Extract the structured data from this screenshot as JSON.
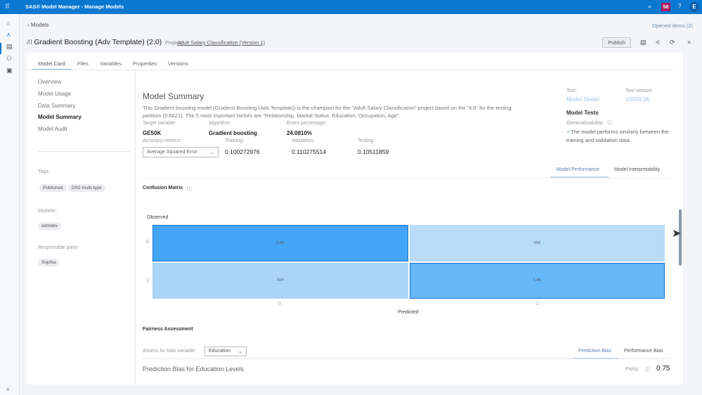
{
  "topbar": {
    "title": "SAS® Model Manager - Manage Models",
    "notifications": "58",
    "avatar": "E",
    "icons": [
      "apps-grid-icon",
      "search-icon",
      "help-icon"
    ]
  },
  "header": {
    "back": "‹ Models",
    "opened_items": "Opened items (2)",
    "model_title": "Gradient Boosting (Adv Template) (2.0)",
    "project_label": "Project:",
    "project_link": "Adult Salary Classification (Version 1)",
    "publish": "Publish"
  },
  "tabs": [
    "Model Card",
    "Files",
    "Variables",
    "Properties",
    "Versions"
  ],
  "nav": [
    "Overview",
    "Model Usage",
    "Data Summary",
    "Model Summary",
    "Model Audit"
  ],
  "sidebar": {
    "tags_label": "Tags:",
    "tags": [
      "Published",
      "DS2 multi-type"
    ],
    "modeler_label": "Modeler:",
    "modeler": "edmdev",
    "responsible_label": "Responsible party:",
    "responsible": "Sophia"
  },
  "summary": {
    "title": "Model Summary",
    "description": "This Gradient boosting model (Gradient Boosting (Adv Template)) is the champion for the \"Adult Salary Classification\" project based on the \"KS\" for the testing partition (0.6621). The 5 most important factors are \"Relationship, Martial Status, Education, Occupation, Age\".",
    "target_label": "Target variable:",
    "target": "GE50K",
    "algorithm_label": "Algorithm:",
    "algorithm": "Gradient boosting",
    "event_label": "Event percentage:",
    "event": "24.0810%",
    "accuracy_label": "Accuracy metrics:",
    "accuracy_metric": "Average Squared Error",
    "training_label": "Training:",
    "training": "0.100272976",
    "validation_label": "Validation:",
    "validation": "0.110275514",
    "testing_label": "Testing:",
    "testing": "0.10511859"
  },
  "tool": {
    "tool_label": "Tool:",
    "tool": "Model Studio",
    "version_label": "Tool version:",
    "version": "V2024.06",
    "tests_title": "Model Tests",
    "gen_label": "Generalizability:",
    "gen_text": "The model performs similarly between the training and validation data."
  },
  "perf_tabs": [
    "Model Performance",
    "Model Interpretability"
  ],
  "confusion": {
    "title": "Confusion Matrix",
    "ylabel": "Observed",
    "xlabel": "Predicted",
    "rows": [
      "0",
      "1"
    ],
    "cols": [
      "0",
      "1"
    ],
    "cells": [
      [
        "6.8K",
        "959"
      ],
      [
        "604",
        "1.4K"
      ]
    ],
    "intensity": [
      [
        1.0,
        0.2
      ],
      [
        0.3,
        0.75
      ]
    ]
  },
  "fairness": {
    "title": "Fairness Assessment",
    "bias_label": "Assess for bias variable:",
    "bias_var": "Education",
    "tabs": [
      "Prediction Bias",
      "Performance Bias"
    ],
    "section_title": "Prediction Bias for Education Levels",
    "parity_label": "Parity:",
    "parity": "0.75"
  }
}
